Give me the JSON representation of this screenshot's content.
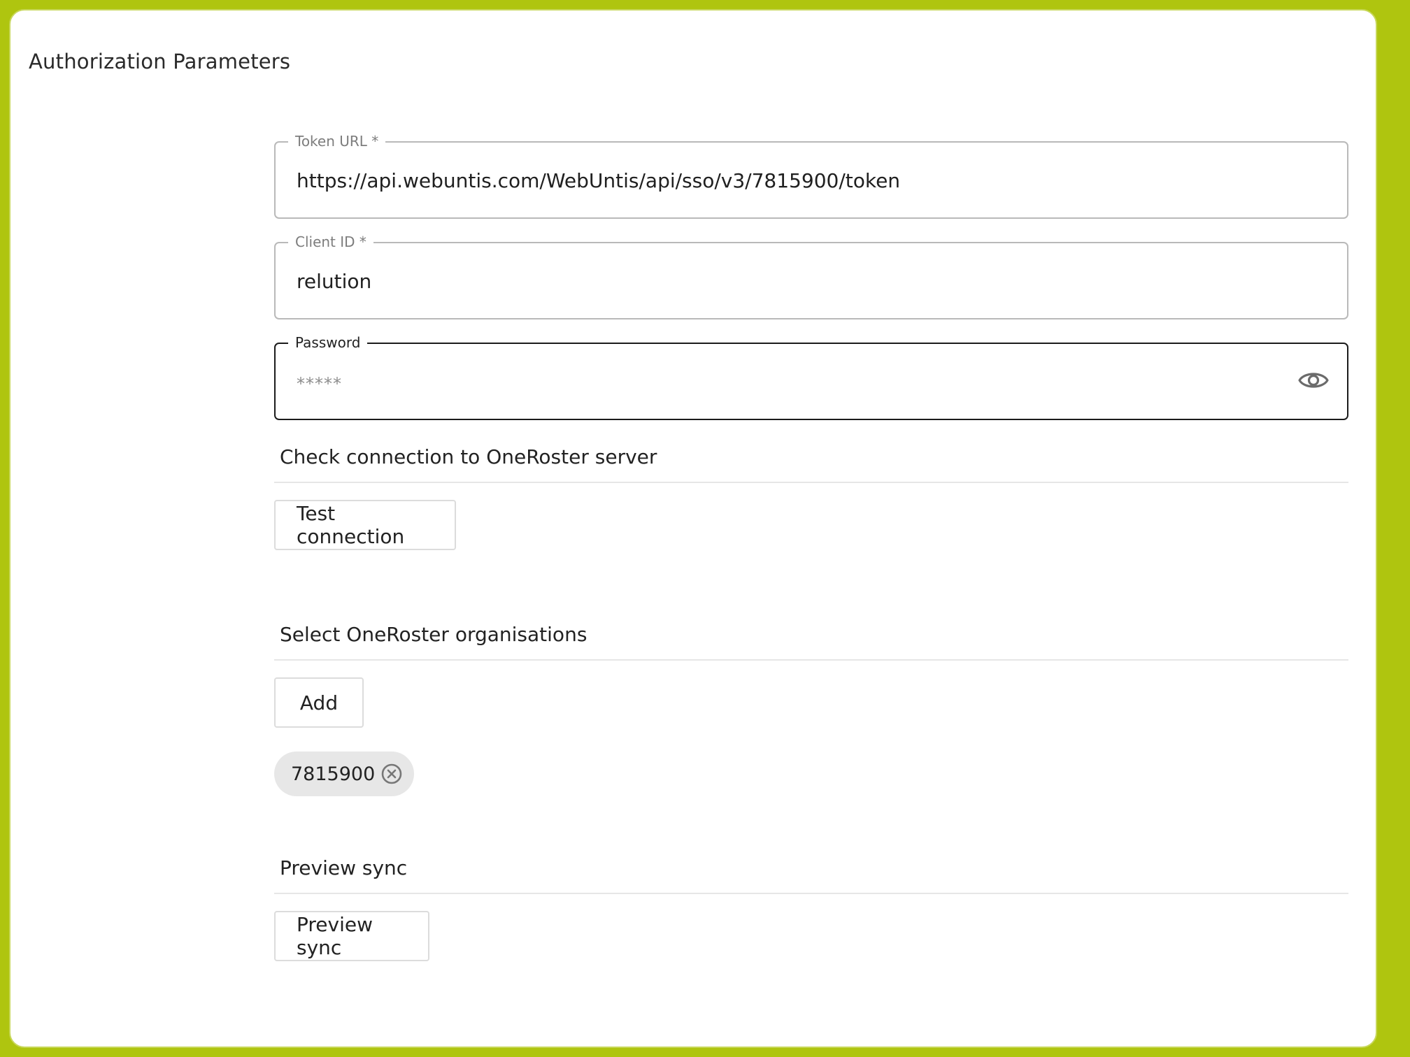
{
  "page": {
    "title": "Authorization Parameters"
  },
  "fields": {
    "token_url": {
      "label": "Token URL *",
      "value": "https://api.webuntis.com/WebUntis/api/sso/v3/7815900/token"
    },
    "client_id": {
      "label": "Client ID *",
      "value": "relution"
    },
    "password": {
      "label": "Password",
      "value": "*****",
      "toggle_icon": "eye-icon"
    }
  },
  "sections": {
    "connection": {
      "title": "Check connection to OneRoster server",
      "button_label": "Test connection"
    },
    "organisations": {
      "title": "Select OneRoster organisations",
      "button_label": "Add",
      "chips": [
        {
          "label": "7815900",
          "remove_icon": "close-circle-icon"
        }
      ]
    },
    "preview": {
      "title": "Preview sync",
      "button_label": "Preview sync"
    }
  },
  "colors": {
    "frame_accent": "#afc50f",
    "focused_border": "#1b1b1b",
    "field_border": "#b9b9b9",
    "chip_background": "#e7e7e7"
  }
}
